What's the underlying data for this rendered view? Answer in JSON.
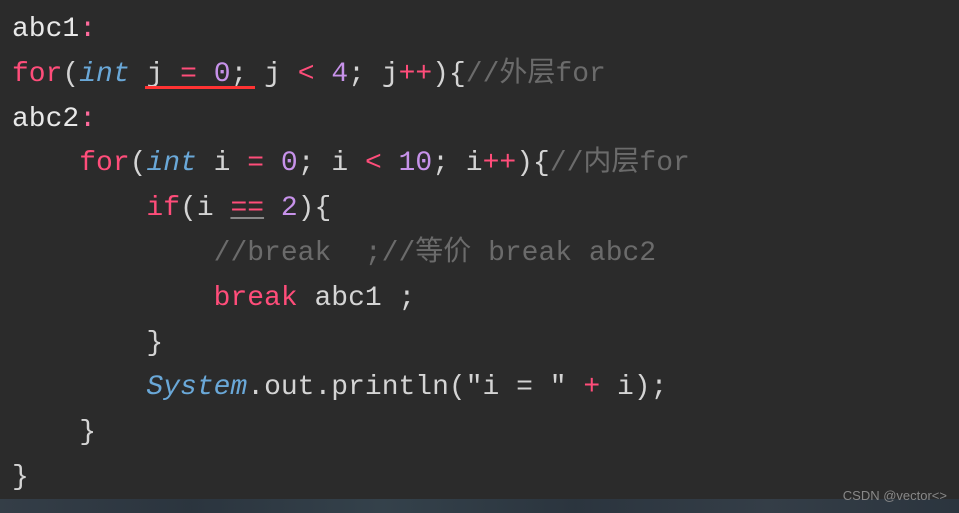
{
  "code": {
    "line1": {
      "label": "abc1",
      "colon": ":"
    },
    "line2": {
      "for": "for",
      "paren_open": "(",
      "type": "int",
      "var": " j ",
      "eq": "=",
      "zero": " 0",
      "semi1": "; ",
      "var2": "j ",
      "lt": "<",
      "four": " 4",
      "semi2": "; ",
      "var3": "j",
      "inc": "++",
      "paren_close": ")",
      "brace": "{",
      "comment": "//外层for"
    },
    "line3": {
      "label": "abc2",
      "colon": ":"
    },
    "line4": {
      "indent": "    ",
      "for": "for",
      "paren_open": "(",
      "type": "int",
      "var": " i ",
      "eq": "=",
      "zero": " 0",
      "semi1": "; ",
      "var2": "i ",
      "lt": "<",
      "ten": " 10",
      "semi2": "; ",
      "var3": "i",
      "inc": "++",
      "paren_close": ")",
      "brace": "{",
      "comment": "//内层for"
    },
    "line5": {
      "indent": "        ",
      "if": "if",
      "paren_open": "(",
      "var": "i ",
      "eqeq": "==",
      "two": " 2",
      "paren_close": ")",
      "brace": "{"
    },
    "line6": {
      "indent": "            ",
      "comment": "//break  ;//等价 break abc2"
    },
    "line7": {
      "indent": "            ",
      "break": "break",
      "target": " abc1 ",
      "semi": ";"
    },
    "line8": {
      "indent": "        ",
      "brace": "}"
    },
    "line9": {
      "indent": "        ",
      "class": "System",
      "dot1": ".",
      "out": "out",
      "dot2": ".",
      "println": "println",
      "paren_open": "(",
      "string": "\"i = \"",
      "plus": " + ",
      "var": "i",
      "paren_close": ")",
      "semi": ";"
    },
    "line10": {
      "indent": "    ",
      "brace": "}"
    },
    "line11": {
      "brace": "}"
    }
  },
  "watermark": "CSDN @vector<>"
}
